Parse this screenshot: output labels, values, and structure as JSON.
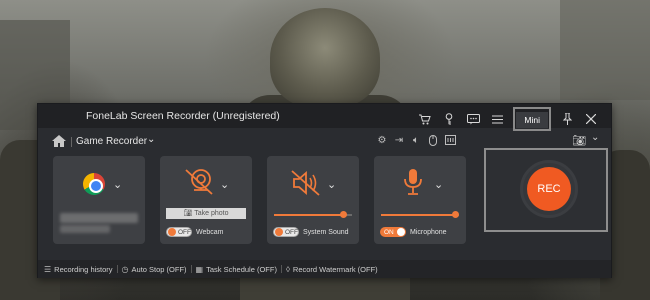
{
  "window": {
    "title": "FoneLab Screen Recorder (Unregistered)",
    "mini_label": "Mini",
    "titlebar_icons": [
      "cart-icon",
      "key-icon",
      "chat-icon",
      "menu-icon",
      "pin-icon",
      "close-icon"
    ]
  },
  "toolbar": {
    "recorder_label": "Game Recorder",
    "tool_icons": [
      "settings-icon",
      "export-icon",
      "speaker-icon",
      "mouse-icon",
      "layout-icon"
    ]
  },
  "cards": {
    "source": {
      "icon": "chrome-icon"
    },
    "webcam": {
      "take_photo_label": "Take photo",
      "toggle_state": "OFF",
      "label": "Webcam"
    },
    "system_sound": {
      "toggle_state": "OFF",
      "label": "System Sound",
      "level": 0.88
    },
    "microphone": {
      "toggle_state": "ON",
      "label": "Microphone",
      "level": 0.95
    }
  },
  "rec": {
    "label": "REC"
  },
  "status_bar": {
    "items": [
      {
        "icon": "list-icon",
        "label": "Recording history"
      },
      {
        "icon": "clock-icon",
        "label": "Auto Stop (OFF)"
      },
      {
        "icon": "calendar-icon",
        "label": "Task Schedule (OFF)"
      },
      {
        "icon": "drop-icon",
        "label": "Record Watermark (OFF)"
      }
    ]
  },
  "colors": {
    "accent": "#f05a22",
    "window_bg": "#2a2c30",
    "card_bg": "#3e4044"
  }
}
